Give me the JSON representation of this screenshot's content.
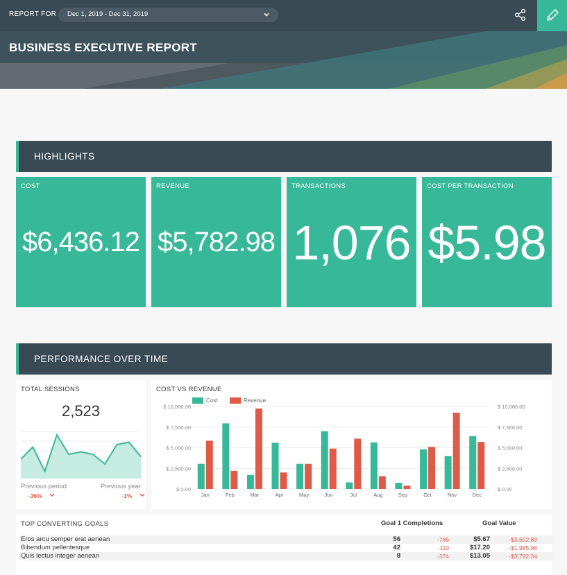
{
  "header": {
    "report_for_label": "REPORT FOR",
    "date_range": "Dec 1, 2019 - Dec 31, 2019",
    "title": "BUSINESS EXECUTIVE REPORT"
  },
  "sections": {
    "highlights": "HIGHLIGHTS",
    "performance": "PERFORMANCE OVER TIME"
  },
  "highlights": [
    {
      "label": "COST",
      "value": "$6,436.12"
    },
    {
      "label": "REVENUE",
      "value": "$5,782.98"
    },
    {
      "label": "TRANSACTIONS",
      "value": "1,076"
    },
    {
      "label": "COST PER TRANSACTION",
      "value": "$5.98"
    }
  ],
  "sessions": {
    "label": "TOTAL SESSIONS",
    "value": "2,523",
    "previous_period_label": "Previous period",
    "previous_period_change": "-36%",
    "previous_year_label": "Previous year",
    "previous_year_change": "-1%",
    "sparkline": [
      8,
      13,
      3,
      18,
      10,
      11,
      10,
      6,
      14,
      15,
      9
    ]
  },
  "cost_vs_revenue": {
    "label": "COST VS REVENUE",
    "left_ticks": [
      "$ 10,000.00",
      "$ 7,500.00",
      "$ 5,000.00",
      "$ 2,500.00",
      "$ 0.00"
    ],
    "right_ticks": [
      "$ 10,000.00",
      "$ 7,500.00",
      "$ 5,000.00",
      "$ 2,500.00",
      "$ 0.00"
    ]
  },
  "chart_data": {
    "type": "bar",
    "title": "COST VS REVENUE",
    "categories": [
      "Jan",
      "Feb",
      "Mar",
      "Apr",
      "May",
      "Jun",
      "Jul",
      "Aug",
      "Sep",
      "Oct",
      "Nov",
      "Dec"
    ],
    "series": [
      {
        "name": "Cost",
        "color": "#37b898",
        "values": [
          3050,
          7950,
          1700,
          5600,
          3050,
          7000,
          800,
          5650,
          750,
          4800,
          4000,
          6400
        ]
      },
      {
        "name": "Revenue",
        "color": "#e05a48",
        "values": [
          5850,
          2200,
          9750,
          2000,
          3050,
          4900,
          6100,
          1550,
          400,
          5100,
          9250,
          5700
        ]
      }
    ],
    "ylim": [
      0,
      10000
    ],
    "grid": true,
    "legend": "top-left"
  },
  "goals": {
    "label": "TOP CONVERTING GOALS",
    "col_completions": "Goal 1 Completions",
    "col_value": "Goal Value",
    "rows": [
      {
        "name": "Eros arcu semper erat aenean",
        "completions": "56",
        "completions_change": "-786",
        "value": "$5.67",
        "value_change": "-$3,652.89"
      },
      {
        "name": "Bibendum pellentesque",
        "completions": "42",
        "completions_change": "-110",
        "value": "$17.20",
        "value_change": "-$1,985.96"
      },
      {
        "name": "Quis lectus integer aenean",
        "completions": "8",
        "completions_change": "-374",
        "value": "$13.05",
        "value_change": "-$3,792.34"
      }
    ]
  },
  "colors": {
    "accent": "#37b898",
    "negative": "#e05a48",
    "dark": "#3a4a55"
  }
}
